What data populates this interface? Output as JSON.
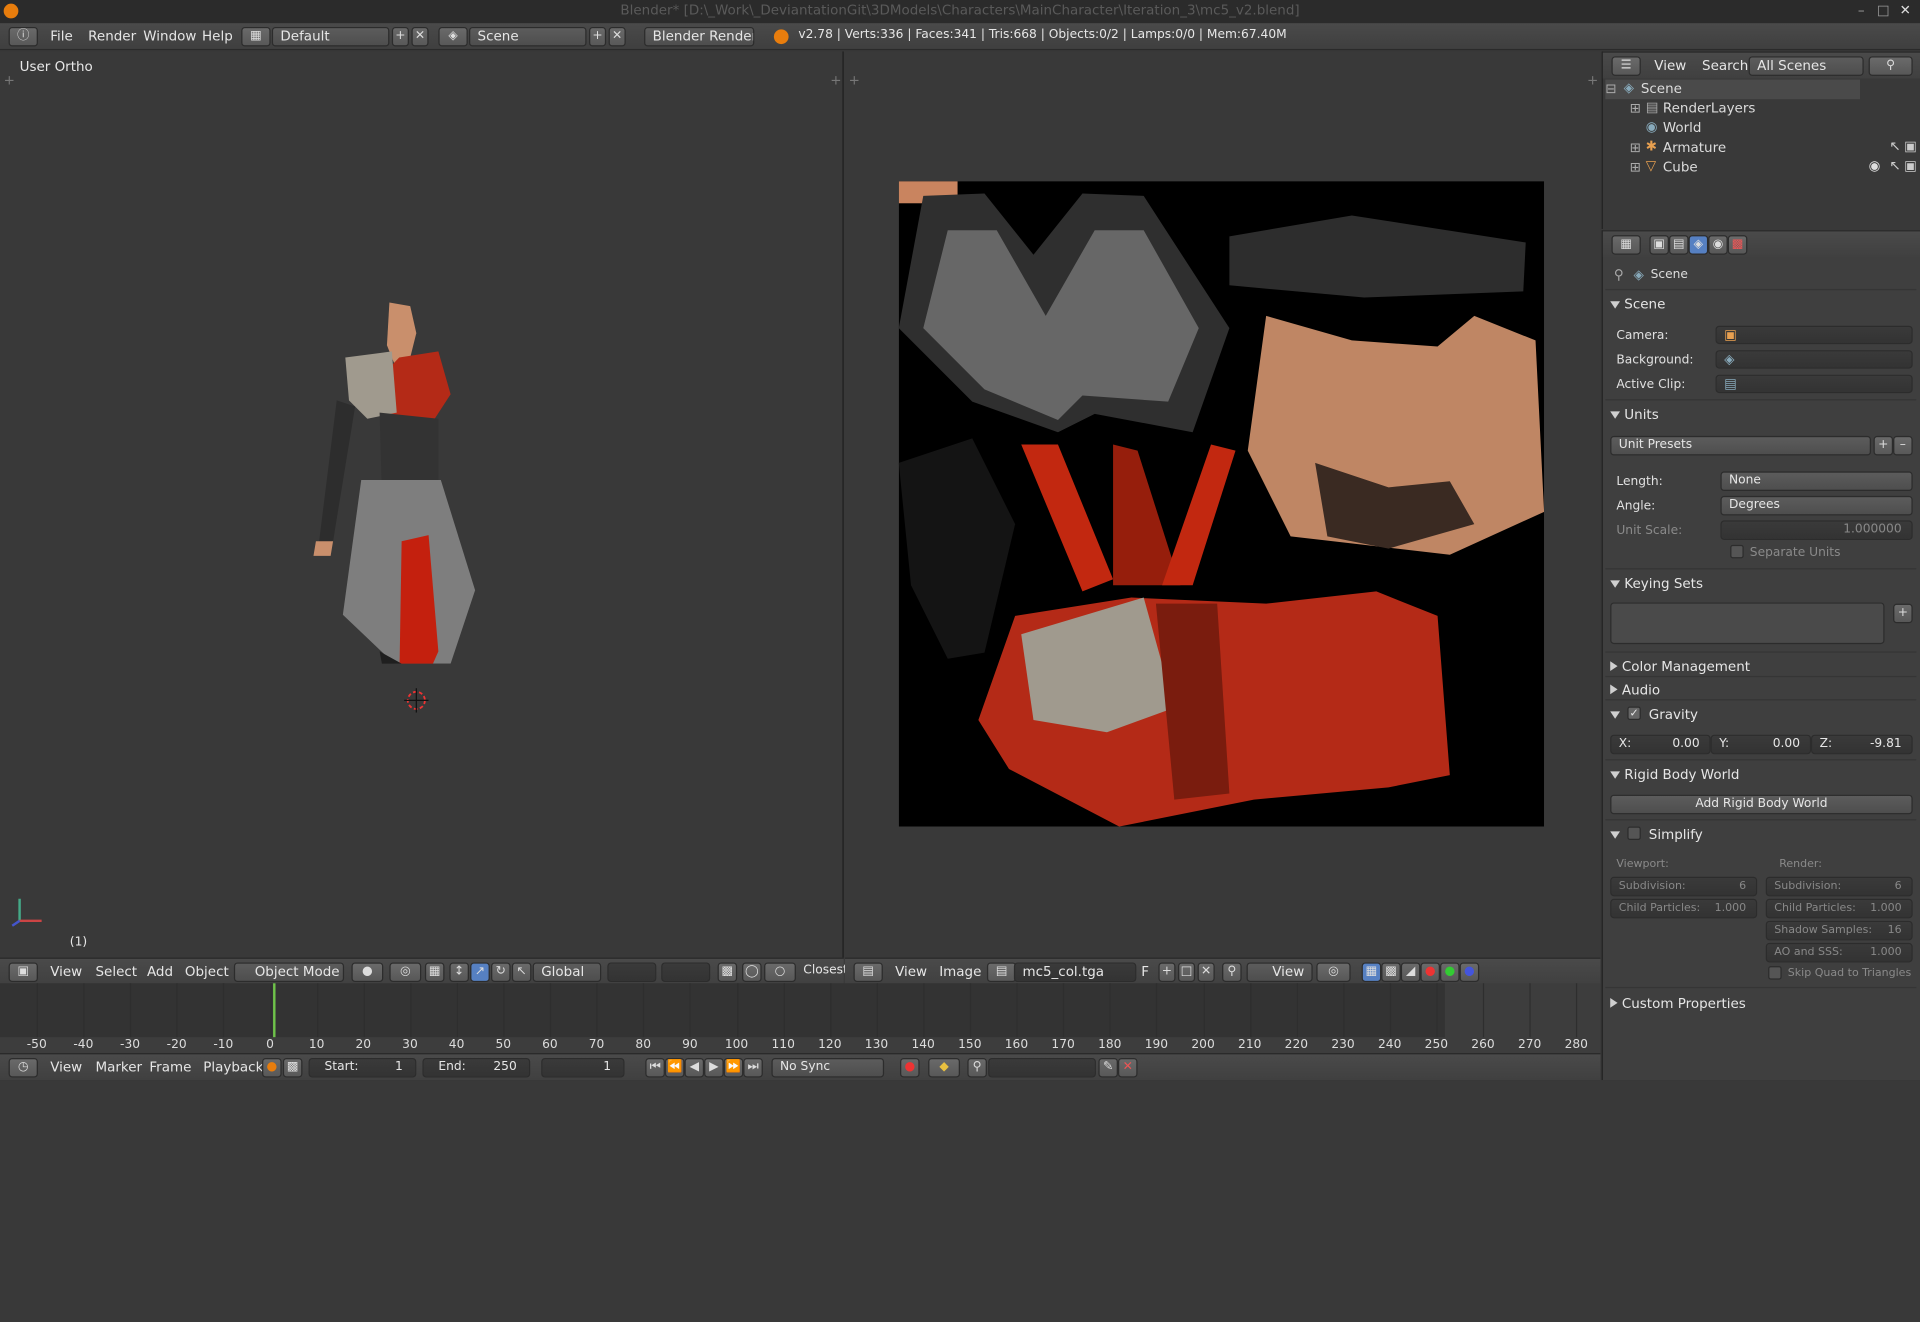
{
  "title": "Blender* [D:\\_Work\\_DeviantationGit\\3DModels\\Characters\\MainCharacter\\Iteration_3\\mc5_v2.blend]",
  "menus": [
    "File",
    "Render",
    "Window",
    "Help"
  ],
  "layout_name": "Default",
  "scene_name": "Scene",
  "render_engine": "Blender Render",
  "stats": "v2.78 | Verts:336 | Faces:341 | Tris:668 | Objects:0/2 | Lamps:0/0 | Mem:67.40M",
  "viewport": {
    "label": "User Ortho",
    "frame": "(1)",
    "header": {
      "view": "View",
      "select": "Select",
      "add": "Add",
      "object": "Object",
      "mode": "Object Mode",
      "orientation": "Global",
      "snap": "Closest"
    }
  },
  "uv_editor": {
    "view": "View",
    "image": "Image",
    "image_name": "mc5_col.tga",
    "f": "F",
    "view2": "View"
  },
  "outliner": {
    "view": "View",
    "search": "Search",
    "filter": "All Scenes",
    "items": [
      {
        "label": "Scene"
      },
      {
        "label": "RenderLayers"
      },
      {
        "label": "World"
      },
      {
        "label": "Armature"
      },
      {
        "label": "Cube"
      }
    ]
  },
  "properties": {
    "context": "Scene",
    "scene_panel": {
      "title": "Scene",
      "camera": "Camera:",
      "background": "Background:",
      "active_clip": "Active Clip:"
    },
    "units": {
      "title": "Units",
      "presets": "Unit Presets",
      "length_label": "Length:",
      "length": "None",
      "angle_label": "Angle:",
      "angle": "Degrees",
      "scale_label": "Unit Scale:",
      "scale": "1.000000",
      "separate": "Separate Units"
    },
    "keying_sets": "Keying Sets",
    "color_management": "Color Management",
    "audio": "Audio",
    "gravity": {
      "title": "Gravity",
      "x_label": "X:",
      "x": "0.00",
      "y_label": "Y:",
      "y": "0.00",
      "z_label": "Z:",
      "z": "-9.81",
      "enabled": true
    },
    "rigid_body": {
      "title": "Rigid Body World",
      "button": "Add Rigid Body World"
    },
    "simplify": {
      "title": "Simplify",
      "viewport": "Viewport:",
      "render": "Render:",
      "subdivision": "Subdivision:",
      "sub_v": "6",
      "sub_r": "6",
      "child": "Child Particles:",
      "child_v": "1.000",
      "child_r": "1.000",
      "shadow": "Shadow Samples:",
      "shadow_v": "16",
      "ao": "AO and SSS:",
      "ao_v": "1.000",
      "skip": "Skip Quad to Triangles"
    },
    "custom_properties": "Custom Properties"
  },
  "timeline": {
    "ticks": [
      "-50",
      "-40",
      "-30",
      "-20",
      "-10",
      "0",
      "10",
      "20",
      "30",
      "40",
      "50",
      "60",
      "70",
      "80",
      "90",
      "100",
      "110",
      "120",
      "130",
      "140",
      "150",
      "160",
      "170",
      "180",
      "190",
      "200",
      "210",
      "220",
      "230",
      "240",
      "250",
      "260",
      "270",
      "280"
    ],
    "current_frame": 1
  },
  "bottom": {
    "view": "View",
    "marker": "Marker",
    "frame": "Frame",
    "playback": "Playback",
    "start_label": "Start:",
    "start": "1",
    "end_label": "End:",
    "end": "250",
    "current": "1",
    "sync": "No Sync"
  },
  "colors": {
    "accent": "#e87d0d",
    "panel": "#3f3f3f",
    "viewport": "#393939",
    "selected": "#5680c2"
  }
}
